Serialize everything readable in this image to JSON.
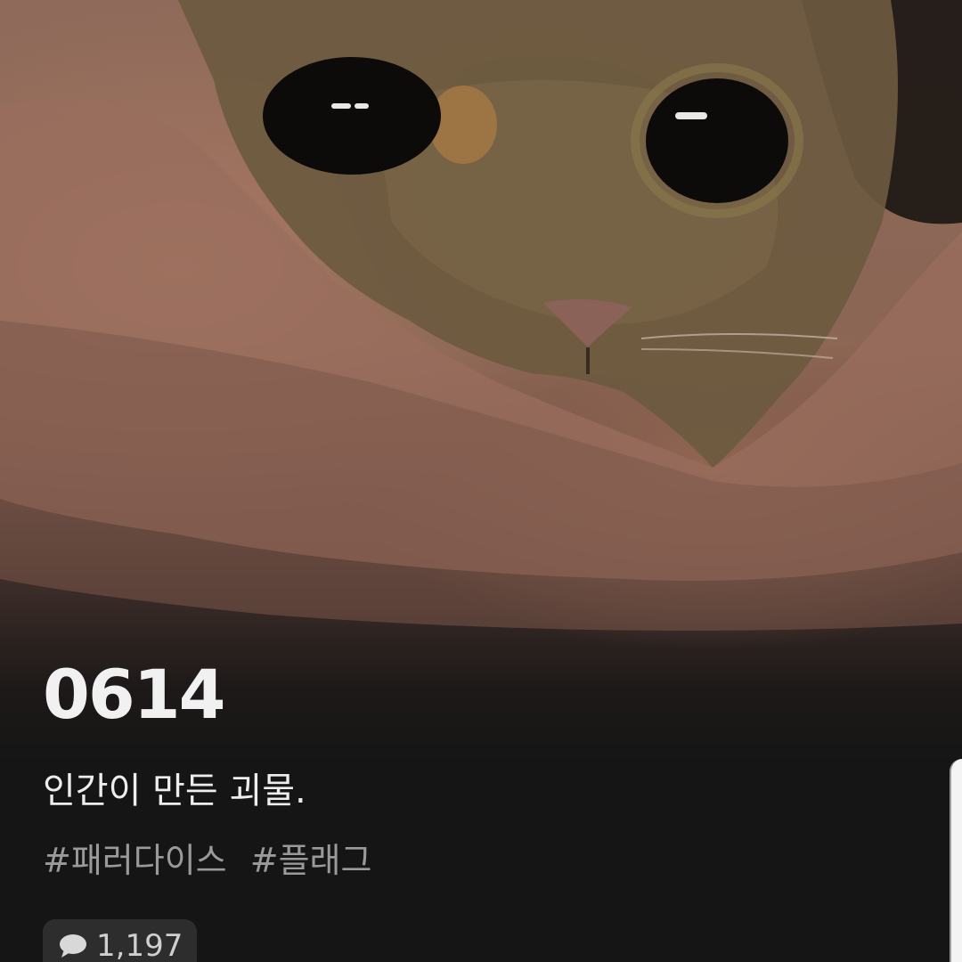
{
  "post": {
    "title": "0614",
    "subtitle": "인간이 만든 괴물.",
    "tags": [
      "#패러다이스",
      "#플래그"
    ],
    "comment_count": "1,197"
  },
  "icons": {
    "comments": "speech-bubble-icon"
  }
}
